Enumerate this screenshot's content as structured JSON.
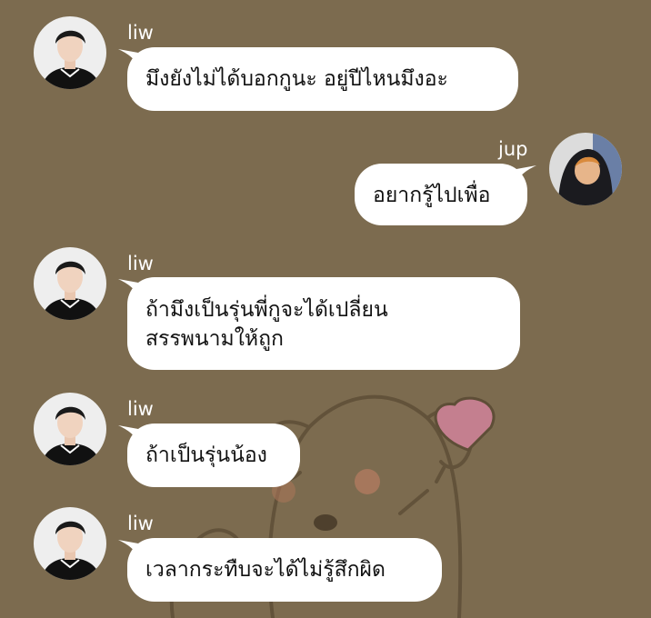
{
  "chat": {
    "background_color": "#7c6b4f",
    "messages": [
      {
        "sender": "liw",
        "side": "left",
        "avatar": "person-avatar-liw",
        "lines": [
          "มึงยังไม่ได้บอกกูนะ อยู่ปีไหนมึงอะ"
        ]
      },
      {
        "sender": "jup",
        "side": "right",
        "avatar": "person-avatar-jup",
        "lines": [
          "อยากรู้ไปเพื่อ"
        ]
      },
      {
        "sender": "liw",
        "side": "left",
        "avatar": "person-avatar-liw",
        "lines": [
          "ถ้ามึงเป็นรุ่นพี่กูจะได้เปลี่ยน",
          "สรรพนามให้ถูก"
        ]
      },
      {
        "sender": "liw",
        "side": "left",
        "avatar": "person-avatar-liw",
        "lines": [
          "ถ้าเป็นรุ่นน้อง"
        ]
      },
      {
        "sender": "liw",
        "side": "left",
        "avatar": "person-avatar-liw",
        "lines": [
          "เวลากระทืบจะได้ไม่รู้สึกผิด"
        ]
      }
    ]
  }
}
